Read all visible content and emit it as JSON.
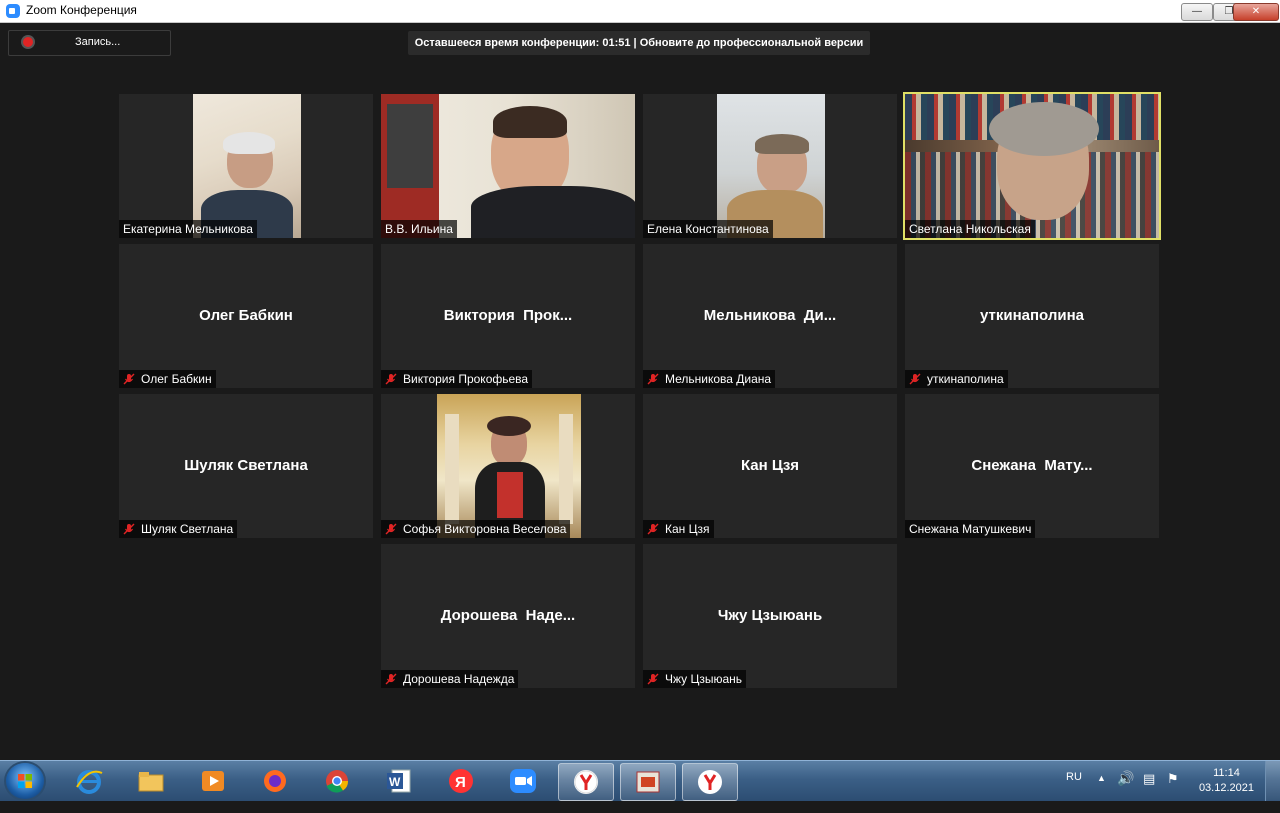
{
  "window": {
    "title": "Zoom Конференция"
  },
  "toolbar": {
    "record_label": "Запись..."
  },
  "banner": {
    "text": "Оставшееся время конференции: 01:51 | Обновите до профессиональной версии"
  },
  "participants": [
    {
      "name": "Екатерина Мельникова",
      "big": "",
      "muted": false
    },
    {
      "name": "В.В. Ильина",
      "big": "",
      "muted": false
    },
    {
      "name": "Елена Константинова",
      "big": "",
      "muted": false
    },
    {
      "name": "Светлана Никольская",
      "big": "",
      "muted": false
    },
    {
      "name": "Олег Бабкин",
      "big": "Олег Бабкин",
      "muted": true
    },
    {
      "name": "Виктория Прокофьева",
      "big": "Виктория  Прок...",
      "muted": true
    },
    {
      "name": "Мельникова Диана",
      "big": "Мельникова  Ди...",
      "muted": true
    },
    {
      "name": "уткинаполина",
      "big": "уткинаполина",
      "muted": true
    },
    {
      "name": "Шуляк Светлана",
      "big": "Шуляк Светлана",
      "muted": true
    },
    {
      "name": "Софья Викторовна Веселова",
      "big": "",
      "muted": true
    },
    {
      "name": "Кан Цзя",
      "big": "Кан Цзя",
      "muted": true
    },
    {
      "name": "Снежана Матушкевич",
      "big": "Снежана  Мату...",
      "muted": false
    },
    {
      "name": "Дорошева Надежда",
      "big": "Дорошева  Наде...",
      "muted": true
    },
    {
      "name": "Чжу Цзыюань",
      "big": "Чжу Цзыюань",
      "muted": true
    }
  ],
  "taskbar": {
    "lang": "RU",
    "time": "11:14",
    "date": "03.12.2021",
    "apps": [
      "explorer-icon",
      "media-player-icon",
      "firefox-icon",
      "chrome-icon",
      "word-icon",
      "yandex-icon",
      "zoom-icon",
      "yandex-browser-icon",
      "presentation-icon",
      "yandex-browser-icon"
    ]
  }
}
